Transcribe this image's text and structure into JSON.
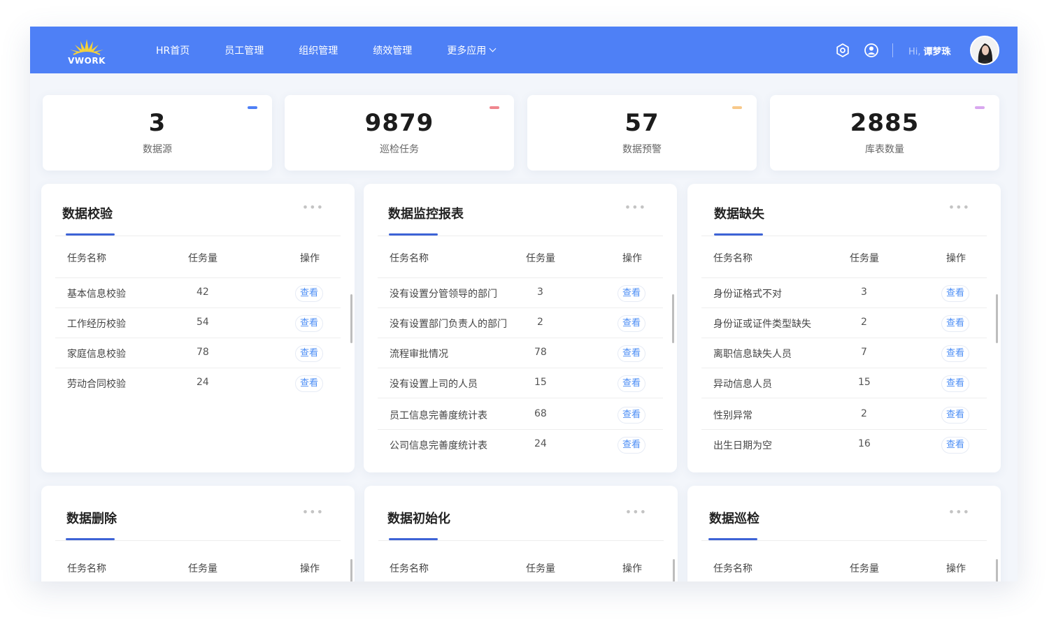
{
  "brand": {
    "logo_text": "VWORK"
  },
  "nav": {
    "items": [
      "HR首页",
      "员工管理",
      "组织管理",
      "绩效管理",
      "更多应用"
    ]
  },
  "header": {
    "icons": [
      "settings-icon",
      "user-icon"
    ],
    "greeting_hi": "Hi,",
    "user_name": "谭梦珠"
  },
  "stats": [
    {
      "value": "3",
      "label": "数据源",
      "color": "#4e80f6"
    },
    {
      "value": "9879",
      "label": "巡检任务",
      "color": "#f0868e"
    },
    {
      "value": "57",
      "label": "数据预警",
      "color": "#f8c98a"
    },
    {
      "value": "2885",
      "label": "库表数量",
      "color": "#d8a7ef"
    }
  ],
  "columns": {
    "name": "任务名称",
    "count": "任务量",
    "action": "操作"
  },
  "action_label": "查看",
  "more_label": "•••",
  "panels": [
    {
      "title": "数据校验",
      "rows": [
        {
          "name": "基本信息校验",
          "count": "42"
        },
        {
          "name": "工作经历校验",
          "count": "54"
        },
        {
          "name": "家庭信息校验",
          "count": "78"
        },
        {
          "name": "劳动合同校验",
          "count": "24"
        }
      ]
    },
    {
      "title": "数据监控报表",
      "rows": [
        {
          "name": "没有设置分管领导的部门",
          "count": "3"
        },
        {
          "name": "没有设置部门负责人的部门",
          "count": "2"
        },
        {
          "name": "流程审批情况",
          "count": "78"
        },
        {
          "name": "没有设置上司的人员",
          "count": "15"
        },
        {
          "name": "员工信息完善度统计表",
          "count": "68"
        },
        {
          "name": "公司信息完善度统计表",
          "count": "24"
        }
      ]
    },
    {
      "title": "数据缺失",
      "rows": [
        {
          "name": "身份证格式不对",
          "count": "3"
        },
        {
          "name": "身份证或证件类型缺失",
          "count": "2"
        },
        {
          "name": "离职信息缺失人员",
          "count": "7"
        },
        {
          "name": "异动信息人员",
          "count": "15"
        },
        {
          "name": "性别异常",
          "count": "2"
        },
        {
          "name": "出生日期为空",
          "count": "16"
        }
      ]
    },
    {
      "title": "数据删除"
    },
    {
      "title": "数据初始化"
    },
    {
      "title": "数据巡检"
    }
  ]
}
